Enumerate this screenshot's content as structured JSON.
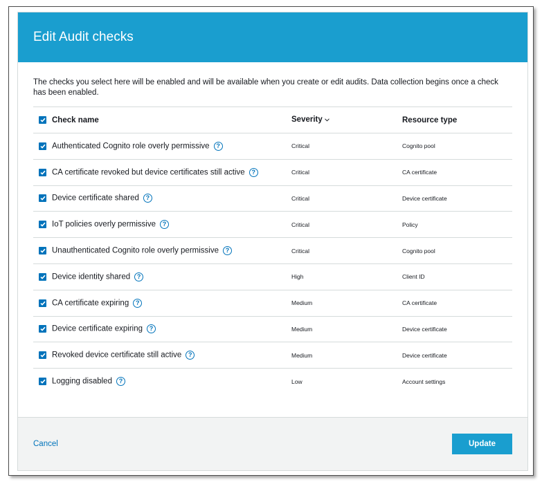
{
  "colors": {
    "header_bg": "#1a9ecf",
    "accent": "#0073bb",
    "primary_button": "#1a9ecf",
    "footer_bg": "#f2f3f3"
  },
  "modal": {
    "title": "Edit Audit checks",
    "description": "The checks you select here will be enabled and will be available when you create or edit audits. Data collection begins once a check has been enabled."
  },
  "table": {
    "headers": {
      "name": "Check name",
      "severity": "Severity",
      "resource": "Resource type"
    },
    "select_all_checked": true,
    "rows": [
      {
        "name": "Authenticated Cognito role overly permissive",
        "severity": "Critical",
        "resource": "Cognito pool",
        "checked": true
      },
      {
        "name": "CA certificate revoked but device certificates still active",
        "severity": "Critical",
        "resource": "CA certificate",
        "checked": true
      },
      {
        "name": "Device certificate shared",
        "severity": "Critical",
        "resource": "Device certificate",
        "checked": true
      },
      {
        "name": "IoT policies overly permissive",
        "severity": "Critical",
        "resource": "Policy",
        "checked": true
      },
      {
        "name": "Unauthenticated Cognito role overly permissive",
        "severity": "Critical",
        "resource": "Cognito pool",
        "checked": true
      },
      {
        "name": "Device identity shared",
        "severity": "High",
        "resource": "Client ID",
        "checked": true
      },
      {
        "name": "CA certificate expiring",
        "severity": "Medium",
        "resource": "CA certificate",
        "checked": true
      },
      {
        "name": "Device certificate expiring",
        "severity": "Medium",
        "resource": "Device certificate",
        "checked": true
      },
      {
        "name": "Revoked device certificate still active",
        "severity": "Medium",
        "resource": "Device certificate",
        "checked": true
      },
      {
        "name": "Logging disabled",
        "severity": "Low",
        "resource": "Account settings",
        "checked": true
      }
    ]
  },
  "footer": {
    "cancel_label": "Cancel",
    "update_label": "Update"
  },
  "icons": {
    "help": "help-circle-icon",
    "sort": "chevron-down-icon",
    "checkbox": "checkmark-icon"
  }
}
